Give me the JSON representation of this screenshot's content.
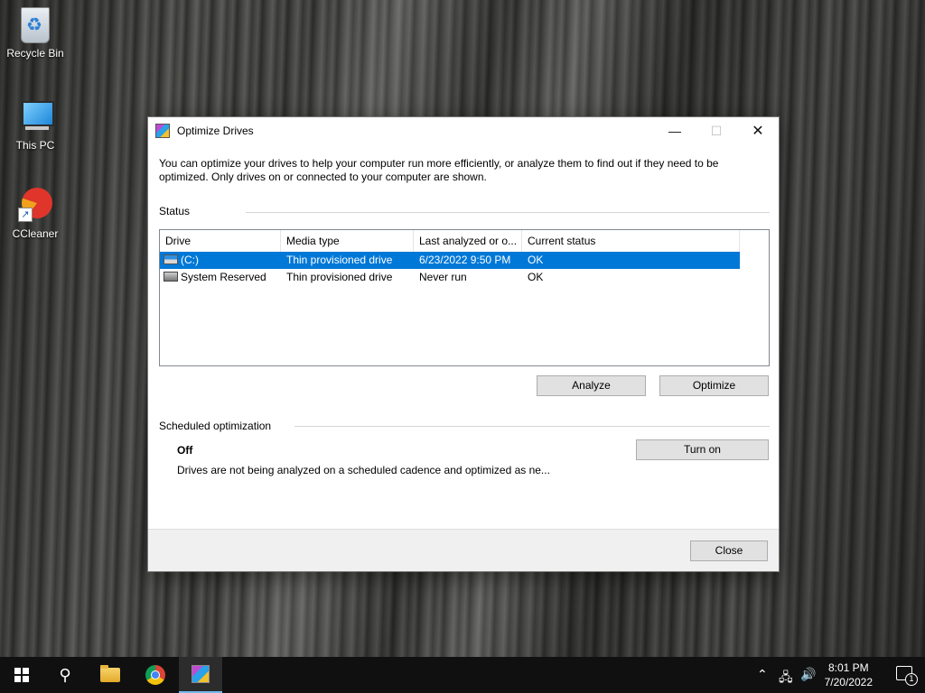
{
  "desktop": {
    "icons": [
      {
        "label": "Recycle Bin",
        "icon": "recycle-bin-icon"
      },
      {
        "label": "This PC",
        "icon": "computer-icon"
      },
      {
        "label": "CCleaner",
        "icon": "ccleaner-icon"
      }
    ]
  },
  "window": {
    "title": "Optimize Drives",
    "description": "You can optimize your drives to help your computer run more efficiently, or analyze them to find out if they need to be optimized. Only drives on or connected to your computer are shown.",
    "status_group": "Status",
    "columns": [
      "Drive",
      "Media type",
      "Last analyzed or o...",
      "Current status"
    ],
    "drives": [
      {
        "drive": "(C:)",
        "media_type": "Thin provisioned drive",
        "last_analyzed": "6/23/2022 9:50 PM",
        "status": "OK",
        "selected": true
      },
      {
        "drive": "System Reserved",
        "media_type": "Thin provisioned drive",
        "last_analyzed": "Never run",
        "status": "OK",
        "selected": false
      }
    ],
    "analyze_label": "Analyze",
    "optimize_label": "Optimize",
    "scheduled_group": "Scheduled optimization",
    "schedule_state": "Off",
    "schedule_description": "Drives are not being analyzed on a scheduled cadence and optimized as ne...",
    "turn_on_label": "Turn on",
    "close_label": "Close",
    "selection_color": "#0078d7"
  },
  "taskbar": {
    "time": "8:01 PM",
    "date": "7/20/2022",
    "notification_count": "1",
    "apps": [
      "start-icon",
      "search-icon",
      "file-explorer-icon",
      "chrome-icon",
      "optimize-drives-icon"
    ]
  }
}
